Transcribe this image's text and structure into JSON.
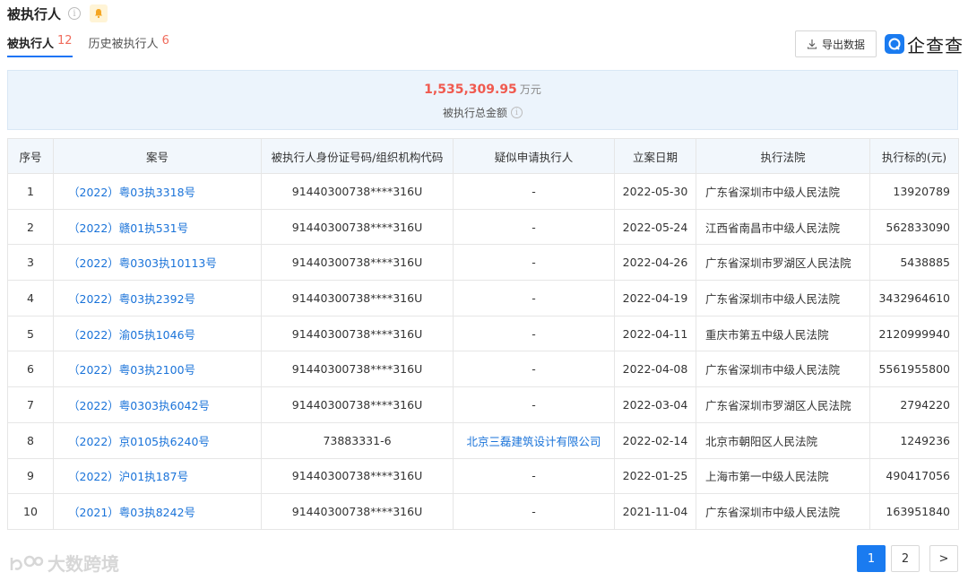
{
  "header": {
    "title": "被执行人",
    "info_glyph": "i"
  },
  "tabs": [
    {
      "label": "被执行人",
      "count": "12"
    },
    {
      "label": "历史被执行人",
      "count": "6"
    }
  ],
  "toolbar": {
    "export_label": "导出数据",
    "logo_text": "企查查"
  },
  "summary": {
    "amount": "1,535,309.95",
    "unit": "万元",
    "label": "被执行总金额",
    "info_glyph": "i"
  },
  "table": {
    "headers": [
      "序号",
      "案号",
      "被执行人身份证号码/组织机构代码",
      "疑似申请执行人",
      "立案日期",
      "执行法院",
      "执行标的(元)"
    ],
    "rows": [
      {
        "no": "1",
        "case": "（2022）粤03执3318号",
        "id": "91440300738****316U",
        "applicant": "-",
        "date": "2022-05-30",
        "court": "广东省深圳市中级人民法院",
        "amount": "13920789"
      },
      {
        "no": "2",
        "case": "（2022）赣01执531号",
        "id": "91440300738****316U",
        "applicant": "-",
        "date": "2022-05-24",
        "court": "江西省南昌市中级人民法院",
        "amount": "562833090"
      },
      {
        "no": "3",
        "case": "（2022）粤0303执10113号",
        "id": "91440300738****316U",
        "applicant": "-",
        "date": "2022-04-26",
        "court": "广东省深圳市罗湖区人民法院",
        "amount": "5438885"
      },
      {
        "no": "4",
        "case": "（2022）粤03执2392号",
        "id": "91440300738****316U",
        "applicant": "-",
        "date": "2022-04-19",
        "court": "广东省深圳市中级人民法院",
        "amount": "3432964610"
      },
      {
        "no": "5",
        "case": "（2022）渝05执1046号",
        "id": "91440300738****316U",
        "applicant": "-",
        "date": "2022-04-11",
        "court": "重庆市第五中级人民法院",
        "amount": "2120999940"
      },
      {
        "no": "6",
        "case": "（2022）粤03执2100号",
        "id": "91440300738****316U",
        "applicant": "-",
        "date": "2022-04-08",
        "court": "广东省深圳市中级人民法院",
        "amount": "5561955800"
      },
      {
        "no": "7",
        "case": "（2022）粤0303执6042号",
        "id": "91440300738****316U",
        "applicant": "-",
        "date": "2022-03-04",
        "court": "广东省深圳市罗湖区人民法院",
        "amount": "2794220"
      },
      {
        "no": "8",
        "case": "（2022）京0105执6240号",
        "id": "73883331-6",
        "applicant": "北京三磊建筑设计有限公司",
        "date": "2022-02-14",
        "court": "北京市朝阳区人民法院",
        "amount": "1249236"
      },
      {
        "no": "9",
        "case": "（2022）沪01执187号",
        "id": "91440300738****316U",
        "applicant": "-",
        "date": "2022-01-25",
        "court": "上海市第一中级人民法院",
        "amount": "490417056"
      },
      {
        "no": "10",
        "case": "（2021）粤03执8242号",
        "id": "91440300738****316U",
        "applicant": "-",
        "date": "2021-11-04",
        "court": "广东省深圳市中级人民法院",
        "amount": "163951840"
      }
    ]
  },
  "pagination": {
    "pages": [
      "1",
      "2"
    ],
    "next": ">"
  },
  "watermark": {
    "text": "大数跨境"
  },
  "colors": {
    "accent": "#1a7bf0",
    "amount_red": "#f05a4f",
    "link_blue": "#1a73d9",
    "summary_bg": "#ecf4fc"
  }
}
